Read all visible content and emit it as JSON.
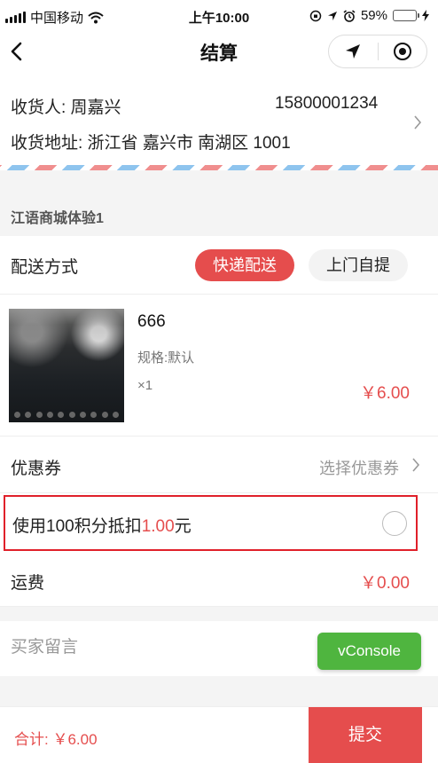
{
  "status_bar": {
    "carrier": "中国移动",
    "time": "上午10:00",
    "battery": "59%",
    "battery_level": 0.59
  },
  "nav": {
    "title": "结算",
    "back_icon": "chevron-left-icon",
    "capsule_icons": [
      "location-arrow-icon",
      "record-target-icon"
    ]
  },
  "address": {
    "recipient": "收货人: 周嘉兴",
    "phone": "15800001234",
    "detail": "收货地址: 浙江省 嘉兴市 南湖区 1001"
  },
  "shop": {
    "name": "江语商城体验1"
  },
  "delivery": {
    "label": "配送方式",
    "options": [
      "快递配送",
      "上门自提"
    ],
    "selected": "快递配送"
  },
  "product": {
    "name": "666",
    "spec": "规格:默认",
    "qty": "×1",
    "price": "￥6.00"
  },
  "coupon": {
    "label": "优惠券",
    "value": "选择优惠券"
  },
  "points": {
    "prefix": "使用100积分抵扣",
    "amount": "1.00",
    "suffix": "元",
    "checked": false
  },
  "freight": {
    "label": "运费",
    "value": "￥0.00"
  },
  "remark": {
    "placeholder": "买家留言",
    "value": ""
  },
  "vconsole": {
    "label": "vConsole"
  },
  "footer": {
    "total": "合计: ￥6.00",
    "submit": "提交"
  },
  "colors": {
    "accent": "#e54d4d",
    "highlight_border": "#e0202a",
    "vconsole": "#4fb53f"
  }
}
